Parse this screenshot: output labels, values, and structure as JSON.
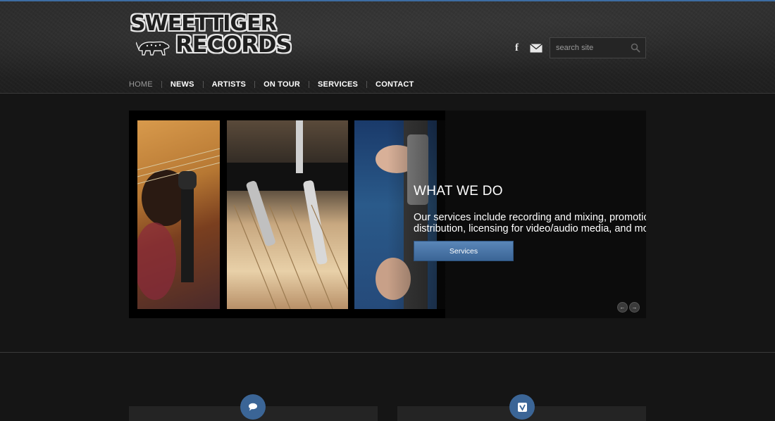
{
  "brand": {
    "logo_line1": "SWEETTIGER",
    "logo_line2": "RECORDS"
  },
  "header": {
    "search_placeholder": "search site",
    "social": {
      "facebook_glyph": "f",
      "mail_icon": "envelope-icon"
    }
  },
  "nav": {
    "items": [
      {
        "label": "HOME",
        "active": true
      },
      {
        "label": "NEWS",
        "active": false
      },
      {
        "label": "ARTISTS",
        "active": false
      },
      {
        "label": "ON TOUR",
        "active": false
      },
      {
        "label": "SERVICES",
        "active": false
      },
      {
        "label": "CONTACT",
        "active": false
      }
    ]
  },
  "slider": {
    "title": "WHAT WE DO",
    "text_line1": "Our services include recording and mixing, promotion,",
    "text_line2": "distribution, licensing for video/audio media, and more.",
    "button_label": "Services",
    "prev_glyph": "←",
    "next_glyph": "→"
  },
  "panels": {
    "left_icon": "speech-bubble-icon",
    "right_icon": "vimeo-icon"
  },
  "colors": {
    "accent": "#3b6596",
    "top_border": "#3d6da3",
    "background": "#151515"
  }
}
